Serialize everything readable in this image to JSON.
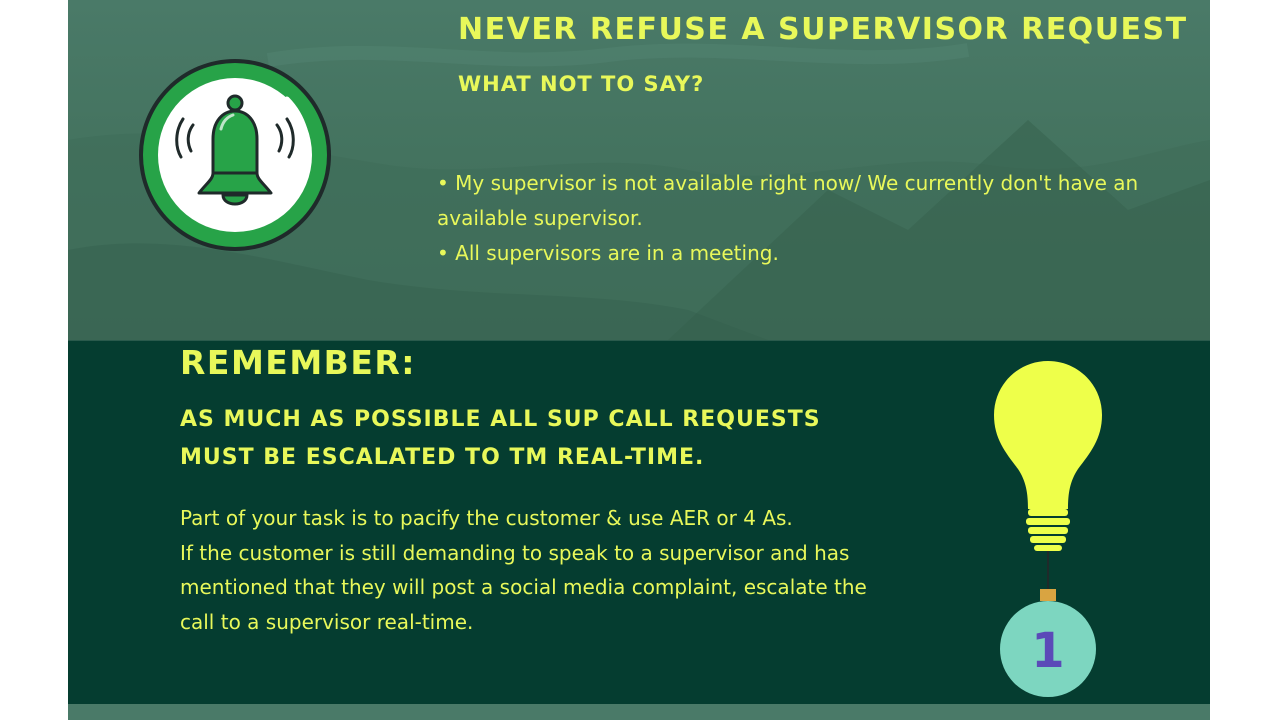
{
  "top": {
    "title": "NEVER REFUSE A SUPERVISOR REQUEST",
    "subtitle": "WHAT NOT TO SAY?",
    "bullets": [
      "• My supervisor is not available right now/ We currently don't have an available supervisor.",
      "• All supervisors are in a meeting."
    ],
    "icon": "bell-icon"
  },
  "bottom": {
    "heading": "REMEMBER:",
    "subheading": "AS MUCH AS POSSIBLE ALL SUP CALL REQUESTS MUST BE ESCALATED TO TM REAL-TIME.",
    "paragraphs": [
      "Part of your task is to pacify the customer & use AER or 4 As.",
      "If the customer is still demanding to speak to a supervisor and has mentioned that they will post a social media complaint, escalate the call to a supervisor real-time."
    ],
    "bulb_icon": "lightbulb-icon",
    "bulb_number": "1"
  },
  "colors": {
    "accent_text": "#e8f85a",
    "top_bg": "#4a7a68",
    "bottom_bg": "#053d30",
    "badge_green": "#27a348",
    "bulb_yellow": "#eeff4a",
    "number_circle": "#7dd6c0",
    "number_color": "#5b4ab8"
  }
}
